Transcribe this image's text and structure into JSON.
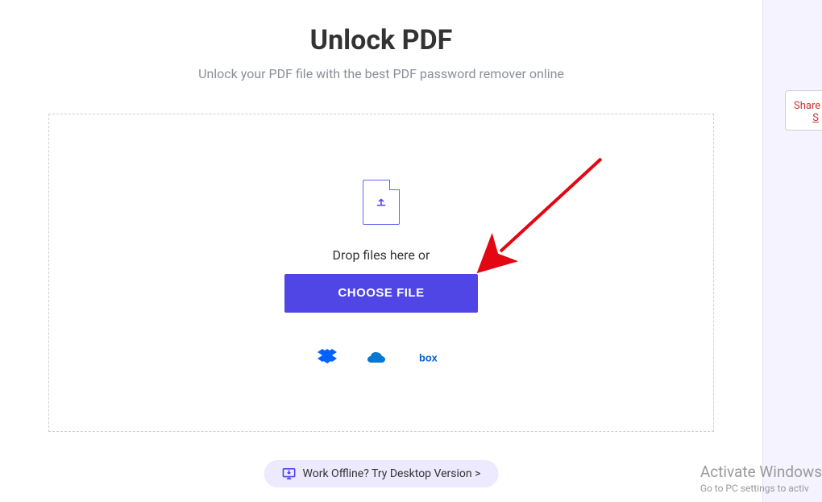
{
  "header": {
    "title": "Unlock PDF",
    "subtitle": "Unlock your PDF file with the best PDF password remover online"
  },
  "dropzone": {
    "drop_text": "Drop files here or",
    "button_label": "CHOOSE FILE"
  },
  "providers": {
    "dropbox": "dropbox",
    "onedrive": "onedrive",
    "box": "box"
  },
  "desktop_link": {
    "label": "Work Offline? Try Desktop Version >"
  },
  "share": {
    "label": "Share",
    "s": "S"
  },
  "watermark": {
    "title": "Activate Windows",
    "sub": "Go to PC settings to activ"
  },
  "colors": {
    "primary": "#4f46e5",
    "accent_arrow": "#e30613",
    "text_muted": "#8a8f99"
  }
}
